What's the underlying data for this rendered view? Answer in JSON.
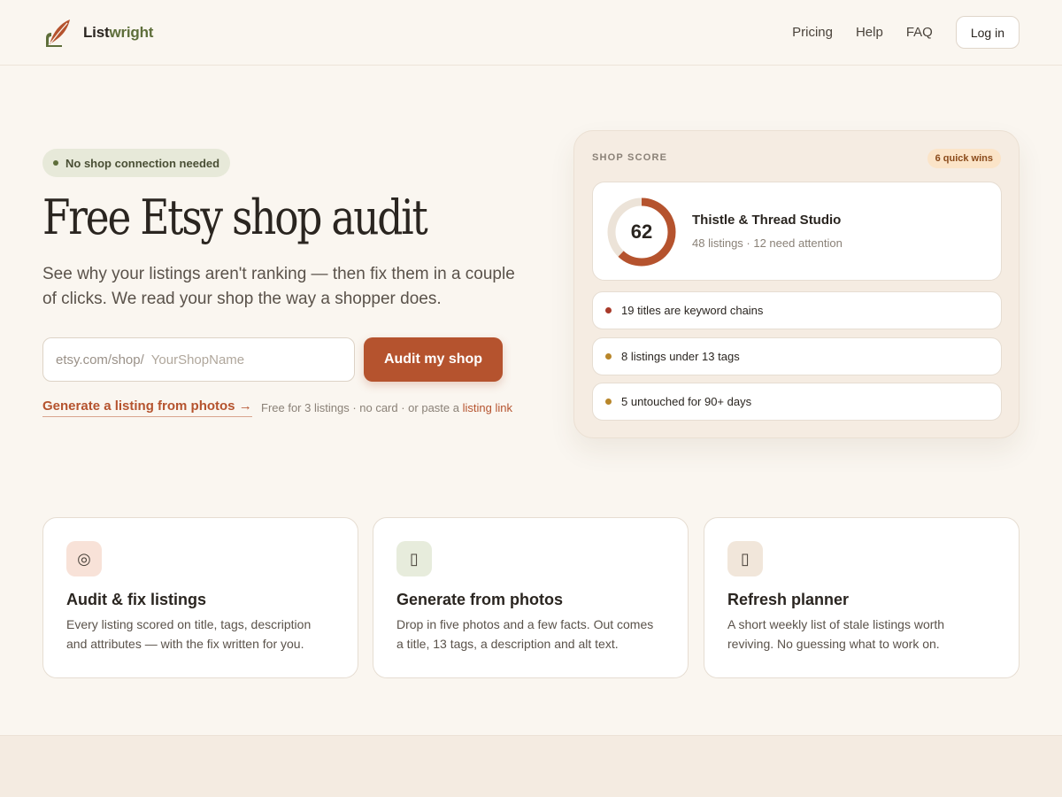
{
  "brand": {
    "name_part1": "List",
    "name_part2": "wright"
  },
  "nav": {
    "items": [
      {
        "label": "Pricing"
      },
      {
        "label": "Help"
      },
      {
        "label": "FAQ"
      }
    ],
    "login_label": "Log in"
  },
  "hero": {
    "pill": "No shop connection needed",
    "title": "Free Etsy shop audit",
    "subtitle": "See why your listings aren't ranking — then fix them in a couple of clicks. We read your shop the way a shopper does.",
    "input_prefix": "etsy.com/shop/",
    "input_placeholder": "YourShopName",
    "input_value": "",
    "audit_button": "Audit my shop",
    "generate_link": "Generate a listing from photos →",
    "note_text": "Free for 3 listings · no card · or paste a ",
    "note_link": "listing link"
  },
  "score_card": {
    "label": "SHOP SCORE",
    "badge": "6 quick wins",
    "score": "62",
    "score_value": 62,
    "shop_name": "Thistle & Thread Studio",
    "shop_meta": "48 listings · 12 need attention",
    "issues": [
      {
        "text": "19 titles are keyword chains",
        "color": "#a83a2a"
      },
      {
        "text": "8 listings under 13 tags",
        "color": "#b8862a"
      },
      {
        "text": "5 untouched for 90+ days",
        "color": "#b8862a"
      }
    ],
    "ring_color": "#b5532e",
    "ring_track": "#ece3d8"
  },
  "features": [
    {
      "icon": "target-icon",
      "glyph": "◎",
      "icon_bg": "#f8e2d8",
      "title": "Audit & fix listings",
      "desc": "Every listing scored on title, tags, description and attributes — with the fix written for you."
    },
    {
      "icon": "photo-icon",
      "glyph": "▯",
      "icon_bg": "#e7ecdc",
      "title": "Generate from photos",
      "desc": "Drop in five photos and a few facts. Out comes a title, 13 tags, a description and alt text."
    },
    {
      "icon": "calendar-icon",
      "glyph": "▯",
      "icon_bg": "#f1e6da",
      "title": "Refresh planner",
      "desc": "A short weekly list of stale listings worth reviving. No guessing what to work on."
    }
  ],
  "colors": {
    "accent": "#b5532e",
    "olive": "#5e6e3a",
    "background": "#faf6f0"
  }
}
